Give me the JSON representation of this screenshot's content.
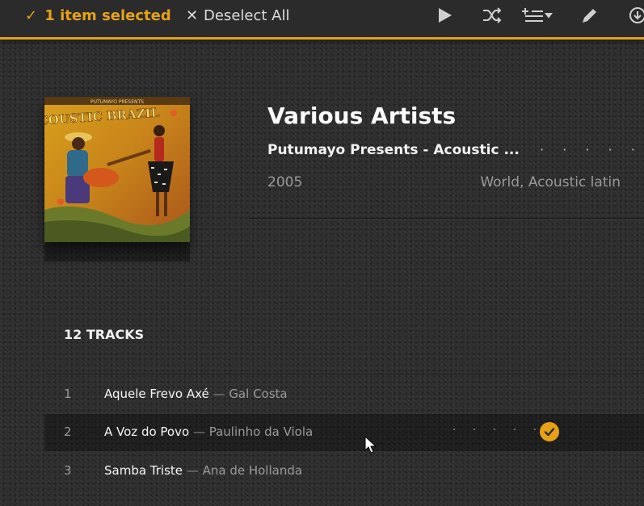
{
  "selection_bar": {
    "selected_icon": "check-icon",
    "selected_label": "1 item selected",
    "deselect_icon": "close-icon",
    "deselect_label": "Deselect All",
    "actions": [
      "play-icon",
      "shuffle-icon",
      "add-to-queue-icon",
      "edit-icon",
      "download-icon"
    ],
    "accent_color": "#e6a117"
  },
  "album": {
    "artist": "Various Artists",
    "title": "Putumayo Presents - Acoustic ...",
    "year": "2005",
    "genres": "World, Acoustic latin",
    "rating_dots": "· · · · ·",
    "cover_text_top": "PUTUMAYO PRESENTS",
    "cover_text_main": "ACOUSTIC BRAZIL"
  },
  "tracks": {
    "heading": "12 TRACKS",
    "rows": [
      {
        "num": "1",
        "title": "Aquele Frevo Axé",
        "sep": "—",
        "artist": "Gal Costa",
        "selected": false
      },
      {
        "num": "2",
        "title": "A Voz do Povo",
        "sep": "—",
        "artist": "Paulinho da Viola",
        "selected": true,
        "rating_dots": "· · · · ·"
      },
      {
        "num": "3",
        "title": "Samba Triste",
        "sep": "—",
        "artist": "Ana de Hollanda",
        "selected": false
      }
    ]
  }
}
